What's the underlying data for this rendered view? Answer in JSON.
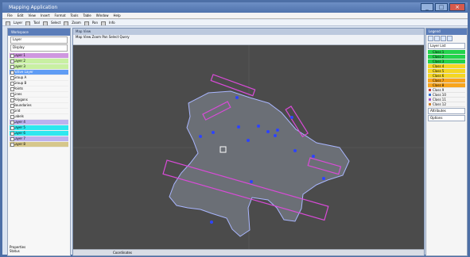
{
  "window": {
    "title": "Mapping Application"
  },
  "menu": [
    "File",
    "Edit",
    "View",
    "Insert",
    "Format",
    "Tools",
    "Table",
    "Window",
    "Help"
  ],
  "toolbar": [
    "Layer",
    "Tool",
    "Select",
    "Zoom",
    "Pan",
    "Info"
  ],
  "left_panel": {
    "header": "Workspace",
    "fields": [
      "Layer",
      "Display"
    ],
    "layers": [
      {
        "label": "Layer 1",
        "cls": "purple"
      },
      {
        "label": "Layer 2",
        "cls": "green"
      },
      {
        "label": "Layer 3",
        "cls": "green"
      },
      {
        "label": "Active Layer",
        "cls": "blue"
      },
      {
        "label": "Group A",
        "cls": ""
      },
      {
        "label": "Group B",
        "cls": ""
      },
      {
        "label": "Points",
        "cls": ""
      },
      {
        "label": "Lines",
        "cls": ""
      },
      {
        "label": "Polygons",
        "cls": ""
      },
      {
        "label": "Boundaries",
        "cls": ""
      },
      {
        "label": "Grid",
        "cls": ""
      },
      {
        "label": "Labels",
        "cls": ""
      },
      {
        "label": "Layer 4",
        "cls": "lav"
      },
      {
        "label": "Layer 5",
        "cls": "cyan"
      },
      {
        "label": "Layer 6",
        "cls": "cyan"
      },
      {
        "label": "Layer 7",
        "cls": "lav"
      },
      {
        "label": "Layer 8",
        "cls": "tan"
      }
    ],
    "footer": [
      "Properties",
      "Status"
    ]
  },
  "map_window": {
    "title": "Map View",
    "bar_items": [
      "Map",
      "View",
      "Zoom",
      "Pan",
      "Select",
      "Query"
    ],
    "status": "Coordinates"
  },
  "right_panel": {
    "header": "Legend",
    "buttons": [
      "Layer List",
      "Attributes",
      "Options"
    ],
    "legend_items": [
      {
        "label": "Class 1",
        "cls": "green"
      },
      {
        "label": "Class 2",
        "cls": "green"
      },
      {
        "label": "Class 3",
        "cls": "green"
      },
      {
        "label": "Class 4",
        "cls": "yellow"
      },
      {
        "label": "Class 5",
        "cls": "yellow"
      },
      {
        "label": "Class 6",
        "cls": "yellow"
      },
      {
        "label": "Class 7",
        "cls": "orange"
      },
      {
        "label": "Class 8",
        "cls": "orange"
      },
      {
        "label": "Class 9",
        "cls": ""
      },
      {
        "label": "Class 10",
        "cls": ""
      },
      {
        "label": "Class 11",
        "cls": ""
      },
      {
        "label": "Class 12",
        "cls": ""
      }
    ]
  },
  "colors": {
    "map_background": "#4a4a4a",
    "landmass": "#6b6f76",
    "landmass_outline": "#a9b6ff",
    "highlight": "#d94bd8",
    "points": "#2d43ff"
  }
}
